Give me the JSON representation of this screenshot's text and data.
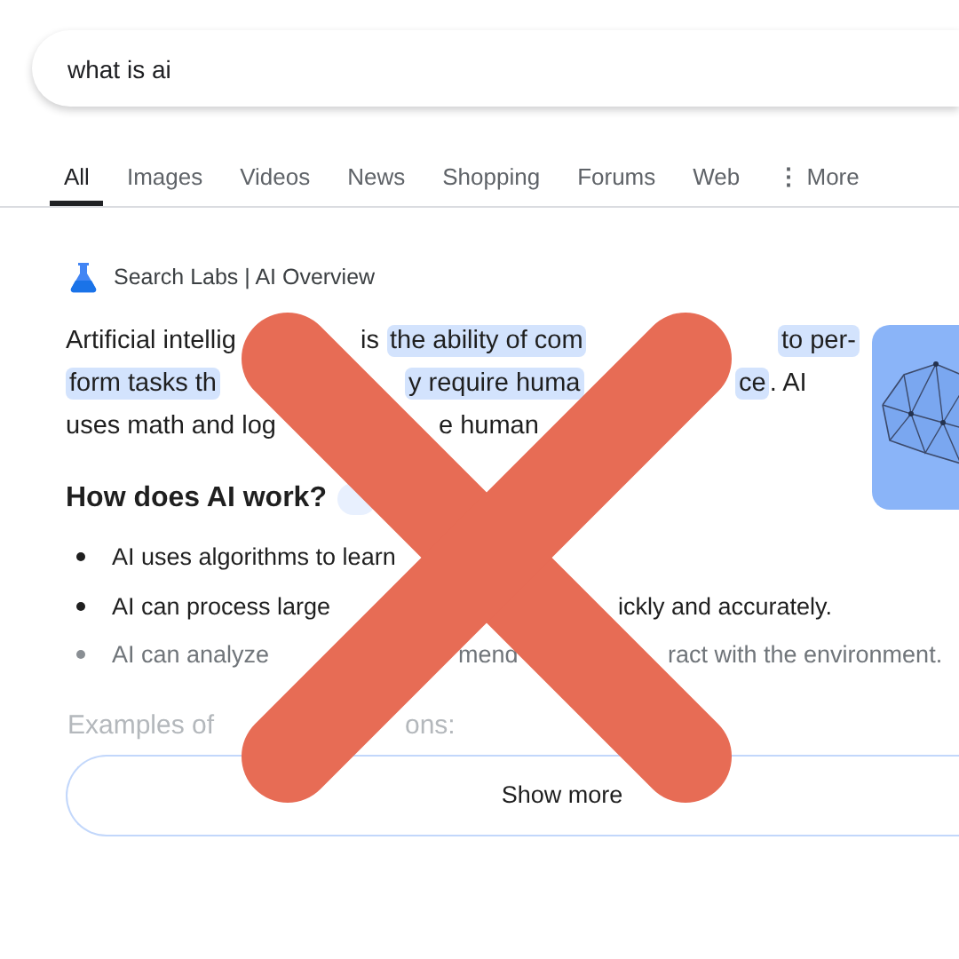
{
  "search": {
    "value": "what is ai"
  },
  "tabs": [
    {
      "label": "All",
      "selected": true,
      "kind": "tab"
    },
    {
      "label": "Images",
      "selected": false,
      "kind": "tab"
    },
    {
      "label": "Videos",
      "selected": false,
      "kind": "tab"
    },
    {
      "label": "News",
      "selected": false,
      "kind": "tab"
    },
    {
      "label": "Shopping",
      "selected": false,
      "kind": "tab"
    },
    {
      "label": "Forums",
      "selected": false,
      "kind": "tab"
    },
    {
      "label": "Web",
      "selected": false,
      "kind": "tab"
    },
    {
      "label": "More",
      "selected": false,
      "kind": "menu",
      "icon": "⋮"
    }
  ],
  "overview": {
    "label": "Search Labs | AI Overview",
    "paragraph": [
      {
        "parts": [
          [
            {
              "text": "Artificial intellig",
              "highlighted": false
            }
          ],
          [
            {
              "text": "is ",
              "highlighted": false
            },
            {
              "text": "the ability of com",
              "highlighted": true
            }
          ],
          [
            {
              "text": "to per-",
              "highlighted": true
            }
          ]
        ]
      },
      {
        "parts": [
          [
            {
              "text": "form tasks th",
              "highlighted": true
            }
          ],
          [
            {
              "text": "y require huma",
              "highlighted": true
            }
          ],
          [
            {
              "text": "ce",
              "highlighted": true
            },
            {
              "text": ". AI",
              "highlighted": false
            }
          ]
        ]
      },
      {
        "parts": [
          [
            {
              "text": "uses math and log",
              "highlighted": false
            }
          ],
          [
            {
              "text": "e human",
              "highlighted": false
            }
          ]
        ]
      }
    ],
    "heading": {
      "parts": [
        [
          {
            "text": "How does AI work?",
            "highlighted": false
          }
        ]
      ]
    },
    "bullets": [
      {
        "dimmed": false,
        "parts": [
          [
            {
              "text": "AI uses algorithms to learn",
              "highlighted": false
            }
          ]
        ]
      },
      {
        "dimmed": false,
        "parts": [
          [
            {
              "text": "AI can process large",
              "highlighted": false
            }
          ],
          [
            {
              "text": "ickly and accurately.",
              "highlighted": false
            }
          ]
        ]
      },
      {
        "dimmed": true,
        "parts": [
          [
            {
              "text": "AI can analyze",
              "highlighted": false
            }
          ],
          [
            {
              "text": "mend",
              "highlighted": false
            }
          ],
          [
            {
              "text": "ract with the environment.",
              "highlighted": false
            }
          ]
        ]
      }
    ],
    "examples": {
      "parts": [
        [
          {
            "text": "Examples of",
            "highlighted": false
          }
        ],
        [
          {
            "text": "ons:",
            "highlighted": false
          }
        ]
      ]
    },
    "show_more": {
      "label": "Show more"
    }
  }
}
